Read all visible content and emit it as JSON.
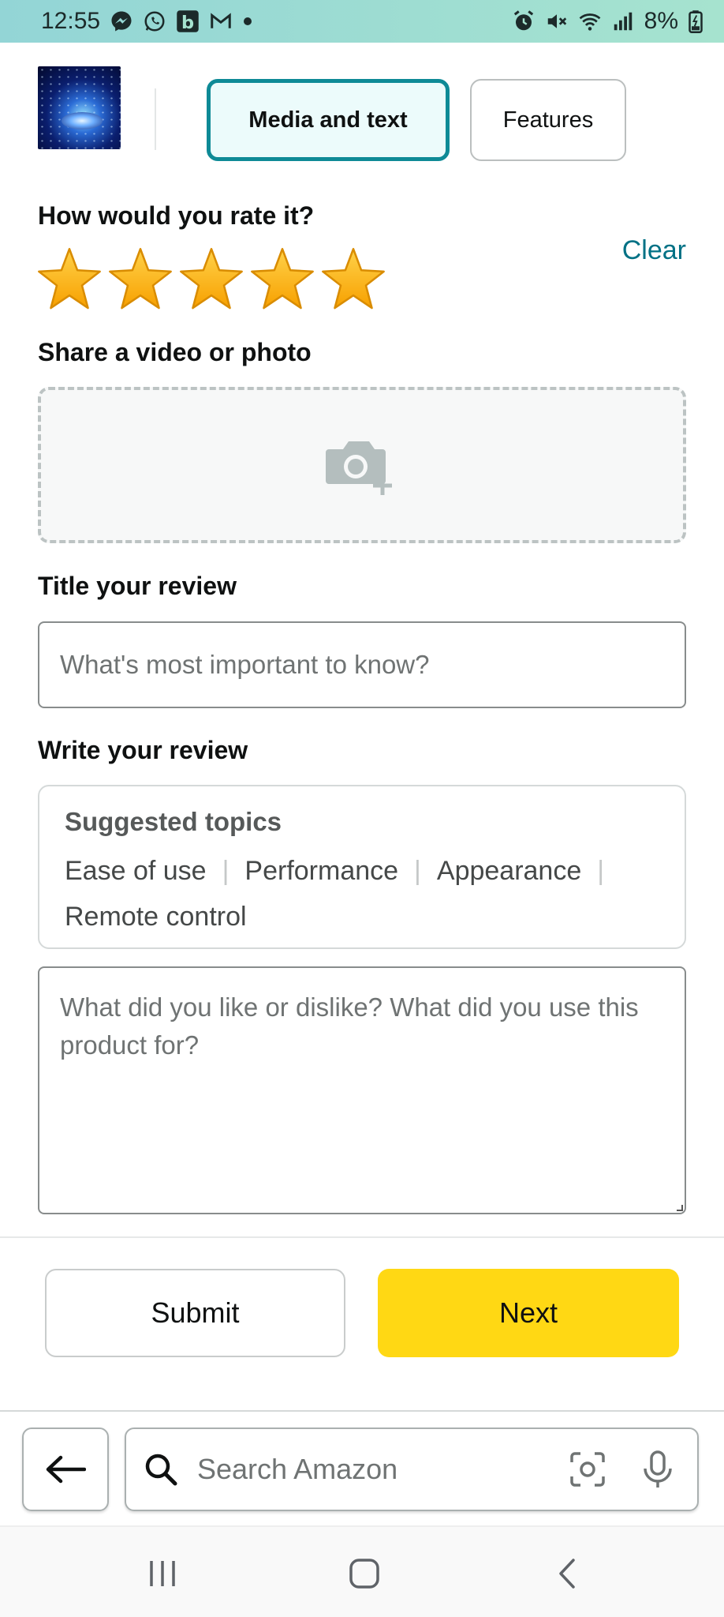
{
  "status_bar": {
    "time": "12:55",
    "battery": "8%"
  },
  "tabs": [
    {
      "label": "Media and text",
      "active": true
    },
    {
      "label": "Features",
      "active": false
    }
  ],
  "rating": {
    "question": "How would you rate it?",
    "clear_label": "Clear",
    "stars_filled": 5,
    "stars_total": 5
  },
  "media": {
    "label": "Share a video or photo"
  },
  "title_review": {
    "label": "Title your review",
    "placeholder": "What's most important to know?"
  },
  "write_review": {
    "label": "Write your review",
    "suggested_title": "Suggested topics",
    "topics": [
      "Ease of use",
      "Performance",
      "Appearance",
      "Remote control"
    ],
    "placeholder": "What did you like or dislike? What did you use this product for?"
  },
  "actions": {
    "submit_label": "Submit",
    "next_label": "Next"
  },
  "search": {
    "placeholder": "Search Amazon"
  },
  "colors": {
    "accent_teal": "#007185",
    "star_gold": "#ffa41c",
    "next_yellow": "#ffd814"
  }
}
